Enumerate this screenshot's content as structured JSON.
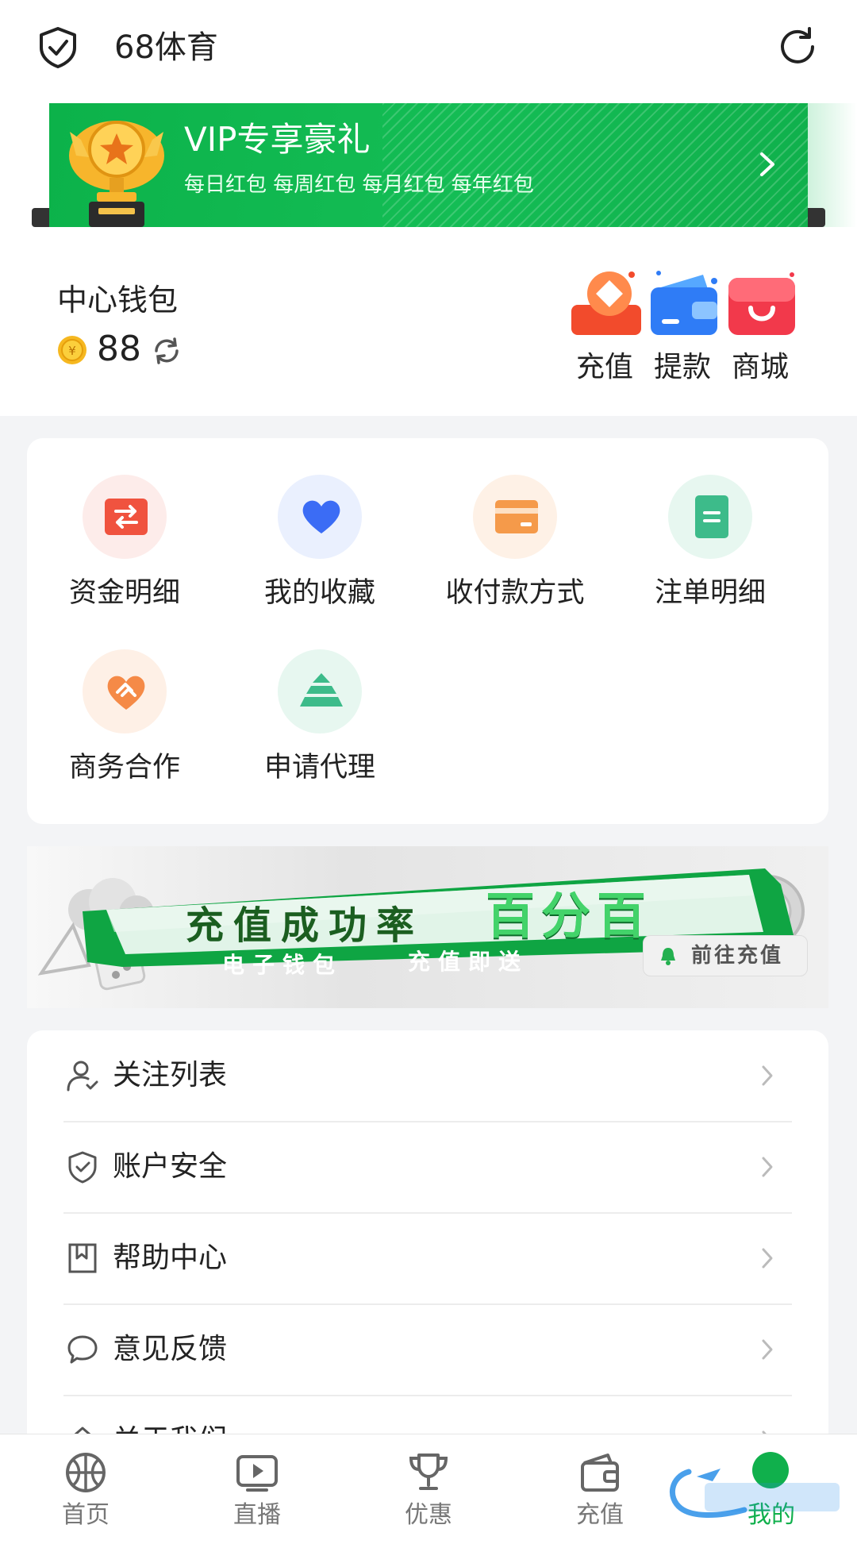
{
  "header": {
    "title": "68体育",
    "shield_icon": "shield-check-icon",
    "refresh_icon": "refresh-icon"
  },
  "vip_banner": {
    "title": "VIP专享豪礼",
    "subtitle": "每日红包 每周红包 每月红包 每年红包",
    "icon": "trophy-icon"
  },
  "wallet": {
    "label": "中心钱包",
    "balance": "88",
    "actions": [
      {
        "label": "充值",
        "icon": "deposit-icon"
      },
      {
        "label": "提款",
        "icon": "withdraw-wallet-icon"
      },
      {
        "label": "商城",
        "icon": "shop-bag-icon"
      }
    ]
  },
  "grid": [
    {
      "label": "资金明细",
      "icon": "transfer-icon",
      "color": "#f0533f",
      "bg": "#fdecea"
    },
    {
      "label": "我的收藏",
      "icon": "heart-icon",
      "color": "#3b6cf5",
      "bg": "#eaf0fe"
    },
    {
      "label": "收付款方式",
      "icon": "card-icon",
      "color": "#f59a4a",
      "bg": "#fef1e6"
    },
    {
      "label": "注单明细",
      "icon": "document-icon",
      "color": "#3dbb8a",
      "bg": "#e7f7f0"
    },
    {
      "label": "商务合作",
      "icon": "handshake-icon",
      "color": "#f58a47",
      "bg": "#fef0e6"
    },
    {
      "label": "申请代理",
      "icon": "pyramid-icon",
      "color": "#3dbb8a",
      "bg": "#e7f7f0"
    }
  ],
  "promo": {
    "headline": "充值成功率",
    "highlight": "百分百",
    "line_left": "电子钱包",
    "line_right": "充值即送",
    "cta": "前往充值"
  },
  "menu": [
    {
      "label": "关注列表",
      "icon": "user-follow-icon"
    },
    {
      "label": "账户安全",
      "icon": "shield-check-icon"
    },
    {
      "label": "帮助中心",
      "icon": "bookmark-icon"
    },
    {
      "label": "意见反馈",
      "icon": "chat-bubble-icon"
    },
    {
      "label": "关于我们",
      "icon": "home-icon"
    }
  ],
  "tabs": [
    {
      "label": "首页",
      "icon": "basketball-icon"
    },
    {
      "label": "直播",
      "icon": "play-video-icon"
    },
    {
      "label": "优惠",
      "icon": "trophy-cup-icon"
    },
    {
      "label": "充值",
      "icon": "wallet-icon"
    },
    {
      "label": "我的",
      "icon": "profile-dot-icon",
      "active": true
    }
  ],
  "colors": {
    "brand_green": "#10b04c",
    "background": "#f3f4f6"
  }
}
